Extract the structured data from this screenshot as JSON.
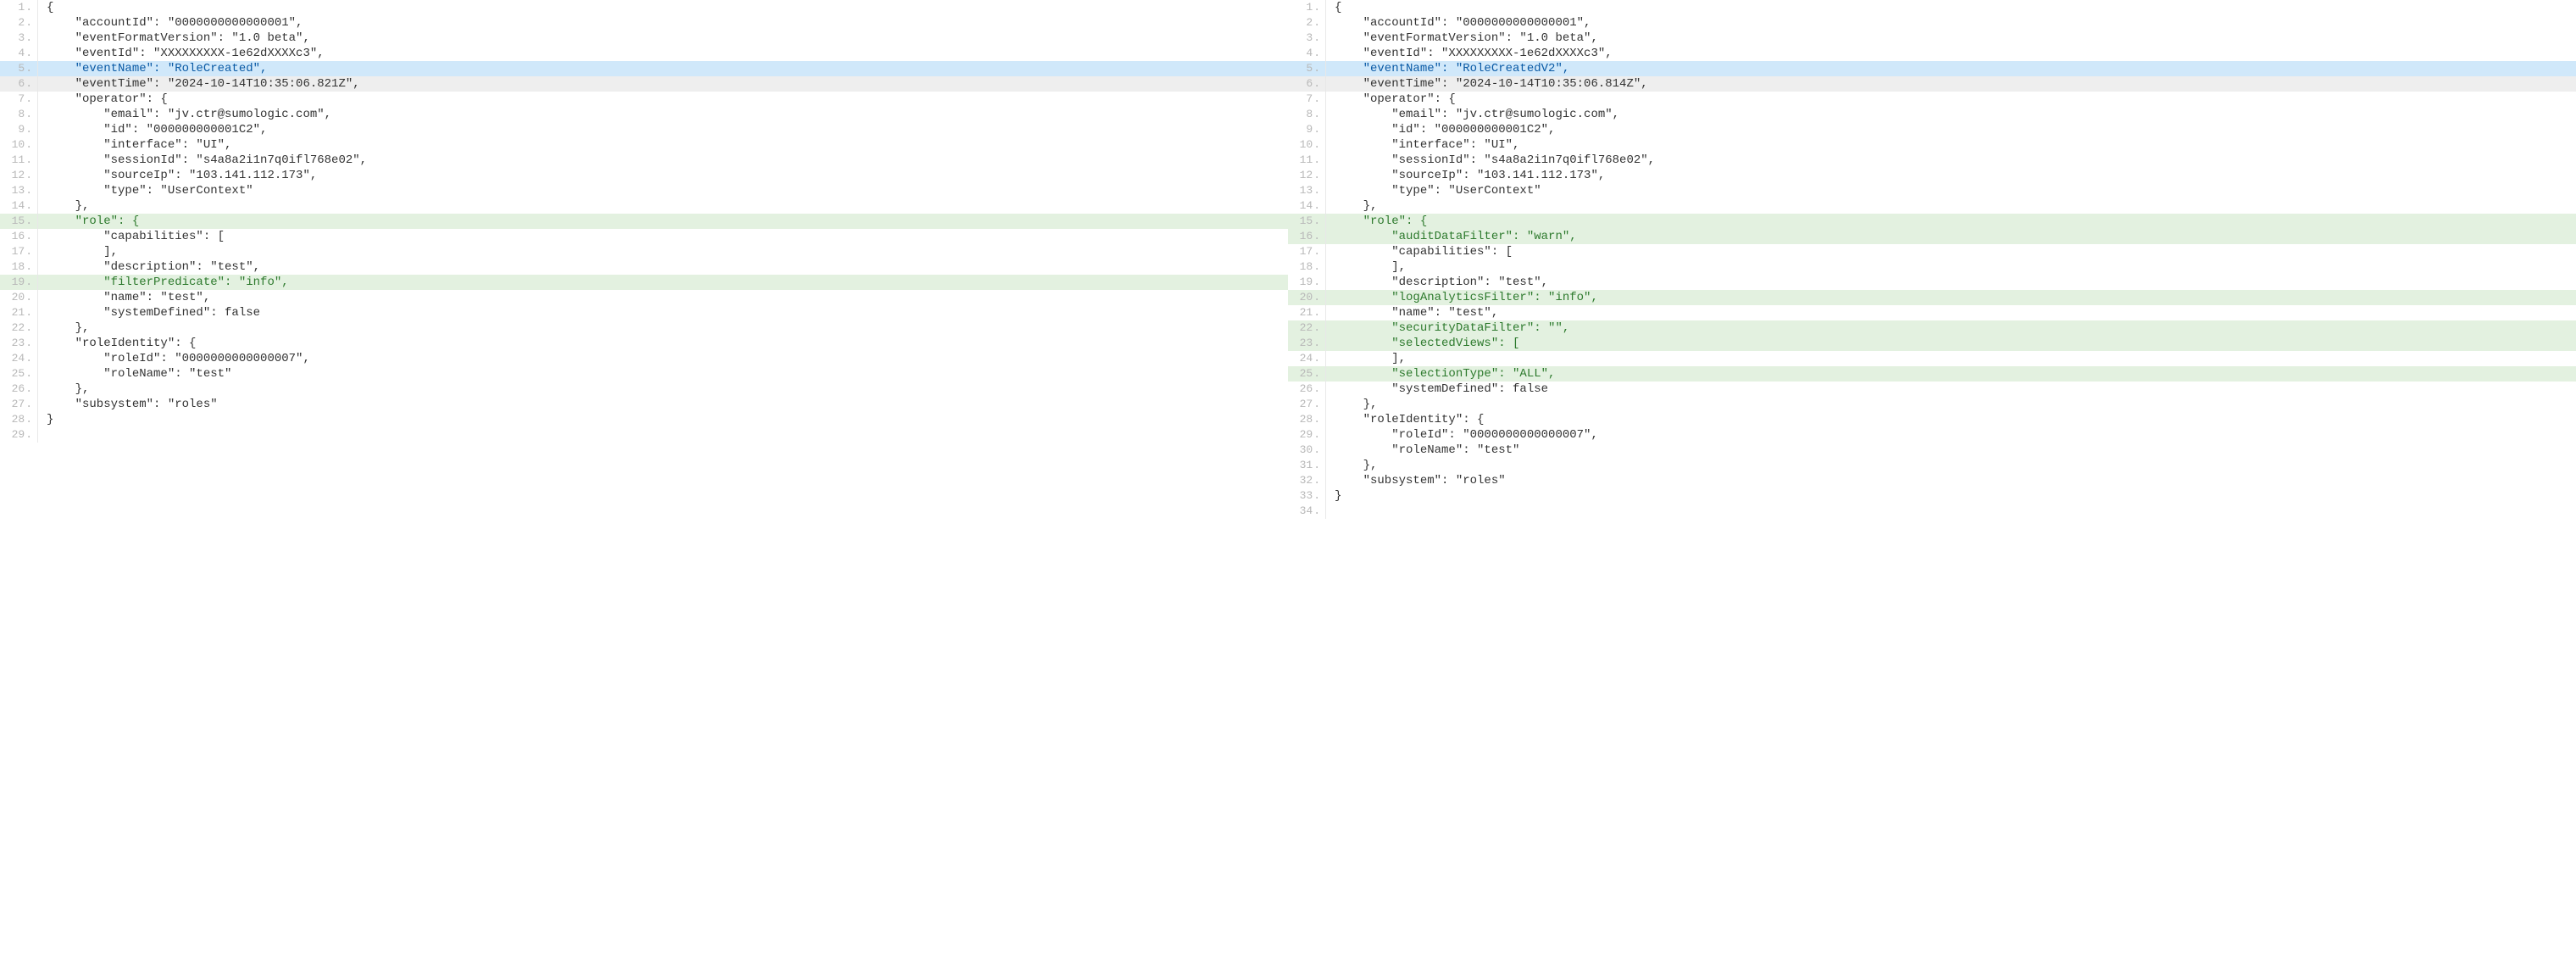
{
  "left": {
    "lines": [
      {
        "n": 1,
        "hl": "",
        "t": "{"
      },
      {
        "n": 2,
        "hl": "",
        "t": "    \"accountId\": \"0000000000000001\","
      },
      {
        "n": 3,
        "hl": "",
        "t": "    \"eventFormatVersion\": \"1.0 beta\","
      },
      {
        "n": 4,
        "hl": "",
        "t": "    \"eventId\": \"XXXXXXXXX-1e62dXXXXc3\","
      },
      {
        "n": 5,
        "hl": "blue",
        "t": "    \"eventName\": \"RoleCreated\","
      },
      {
        "n": 6,
        "hl": "gray",
        "t": "    \"eventTime\": \"2024-10-14T10:35:06.821Z\","
      },
      {
        "n": 7,
        "hl": "",
        "t": "    \"operator\": {"
      },
      {
        "n": 8,
        "hl": "",
        "t": "        \"email\": \"jv.ctr@sumologic.com\","
      },
      {
        "n": 9,
        "hl": "",
        "t": "        \"id\": \"000000000001C2\","
      },
      {
        "n": 10,
        "hl": "",
        "t": "        \"interface\": \"UI\","
      },
      {
        "n": 11,
        "hl": "",
        "t": "        \"sessionId\": \"s4a8a2i1n7q0ifl768e02\","
      },
      {
        "n": 12,
        "hl": "",
        "t": "        \"sourceIp\": \"103.141.112.173\","
      },
      {
        "n": 13,
        "hl": "",
        "t": "        \"type\": \"UserContext\""
      },
      {
        "n": 14,
        "hl": "",
        "t": "    },"
      },
      {
        "n": 15,
        "hl": "green",
        "t": "    \"role\": {"
      },
      {
        "n": 16,
        "hl": "",
        "t": "        \"capabilities\": ["
      },
      {
        "n": 17,
        "hl": "",
        "t": "        ],"
      },
      {
        "n": 18,
        "hl": "",
        "t": "        \"description\": \"test\","
      },
      {
        "n": 19,
        "hl": "green",
        "t": "        \"filterPredicate\": \"info\","
      },
      {
        "n": 20,
        "hl": "",
        "t": "        \"name\": \"test\","
      },
      {
        "n": 21,
        "hl": "",
        "t": "        \"systemDefined\": false"
      },
      {
        "n": 22,
        "hl": "",
        "t": "    },"
      },
      {
        "n": 23,
        "hl": "",
        "t": "    \"roleIdentity\": {"
      },
      {
        "n": 24,
        "hl": "",
        "t": "        \"roleId\": \"0000000000000007\","
      },
      {
        "n": 25,
        "hl": "",
        "t": "        \"roleName\": \"test\""
      },
      {
        "n": 26,
        "hl": "",
        "t": "    },"
      },
      {
        "n": 27,
        "hl": "",
        "t": "    \"subsystem\": \"roles\""
      },
      {
        "n": 28,
        "hl": "",
        "t": "}"
      },
      {
        "n": 29,
        "hl": "",
        "t": ""
      }
    ]
  },
  "right": {
    "lines": [
      {
        "n": 1,
        "hl": "",
        "t": "{"
      },
      {
        "n": 2,
        "hl": "",
        "t": "    \"accountId\": \"0000000000000001\","
      },
      {
        "n": 3,
        "hl": "",
        "t": "    \"eventFormatVersion\": \"1.0 beta\","
      },
      {
        "n": 4,
        "hl": "",
        "t": "    \"eventId\": \"XXXXXXXXX-1e62dXXXXc3\","
      },
      {
        "n": 5,
        "hl": "blue",
        "t": "    \"eventName\": \"RoleCreatedV2\","
      },
      {
        "n": 6,
        "hl": "gray",
        "t": "    \"eventTime\": \"2024-10-14T10:35:06.814Z\","
      },
      {
        "n": 7,
        "hl": "",
        "t": "    \"operator\": {"
      },
      {
        "n": 8,
        "hl": "",
        "t": "        \"email\": \"jv.ctr@sumologic.com\","
      },
      {
        "n": 9,
        "hl": "",
        "t": "        \"id\": \"000000000001C2\","
      },
      {
        "n": 10,
        "hl": "",
        "t": "        \"interface\": \"UI\","
      },
      {
        "n": 11,
        "hl": "",
        "t": "        \"sessionId\": \"s4a8a2i1n7q0ifl768e02\","
      },
      {
        "n": 12,
        "hl": "",
        "t": "        \"sourceIp\": \"103.141.112.173\","
      },
      {
        "n": 13,
        "hl": "",
        "t": "        \"type\": \"UserContext\""
      },
      {
        "n": 14,
        "hl": "",
        "t": "    },"
      },
      {
        "n": 15,
        "hl": "green",
        "t": "    \"role\": {"
      },
      {
        "n": 16,
        "hl": "green",
        "t": "        \"auditDataFilter\": \"warn\","
      },
      {
        "n": 17,
        "hl": "",
        "t": "        \"capabilities\": ["
      },
      {
        "n": 18,
        "hl": "",
        "t": "        ],"
      },
      {
        "n": 19,
        "hl": "",
        "t": "        \"description\": \"test\","
      },
      {
        "n": 20,
        "hl": "green",
        "t": "        \"logAnalyticsFilter\": \"info\","
      },
      {
        "n": 21,
        "hl": "",
        "t": "        \"name\": \"test\","
      },
      {
        "n": 22,
        "hl": "green",
        "t": "        \"securityDataFilter\": \"\","
      },
      {
        "n": 23,
        "hl": "green",
        "t": "        \"selectedViews\": ["
      },
      {
        "n": 24,
        "hl": "",
        "t": "        ],"
      },
      {
        "n": 25,
        "hl": "green",
        "t": "        \"selectionType\": \"ALL\","
      },
      {
        "n": 26,
        "hl": "",
        "t": "        \"systemDefined\": false"
      },
      {
        "n": 27,
        "hl": "",
        "t": "    },"
      },
      {
        "n": 28,
        "hl": "",
        "t": "    \"roleIdentity\": {"
      },
      {
        "n": 29,
        "hl": "",
        "t": "        \"roleId\": \"0000000000000007\","
      },
      {
        "n": 30,
        "hl": "",
        "t": "        \"roleName\": \"test\""
      },
      {
        "n": 31,
        "hl": "",
        "t": "    },"
      },
      {
        "n": 32,
        "hl": "",
        "t": "    \"subsystem\": \"roles\""
      },
      {
        "n": 33,
        "hl": "",
        "t": "}"
      },
      {
        "n": 34,
        "hl": "",
        "t": ""
      }
    ]
  }
}
